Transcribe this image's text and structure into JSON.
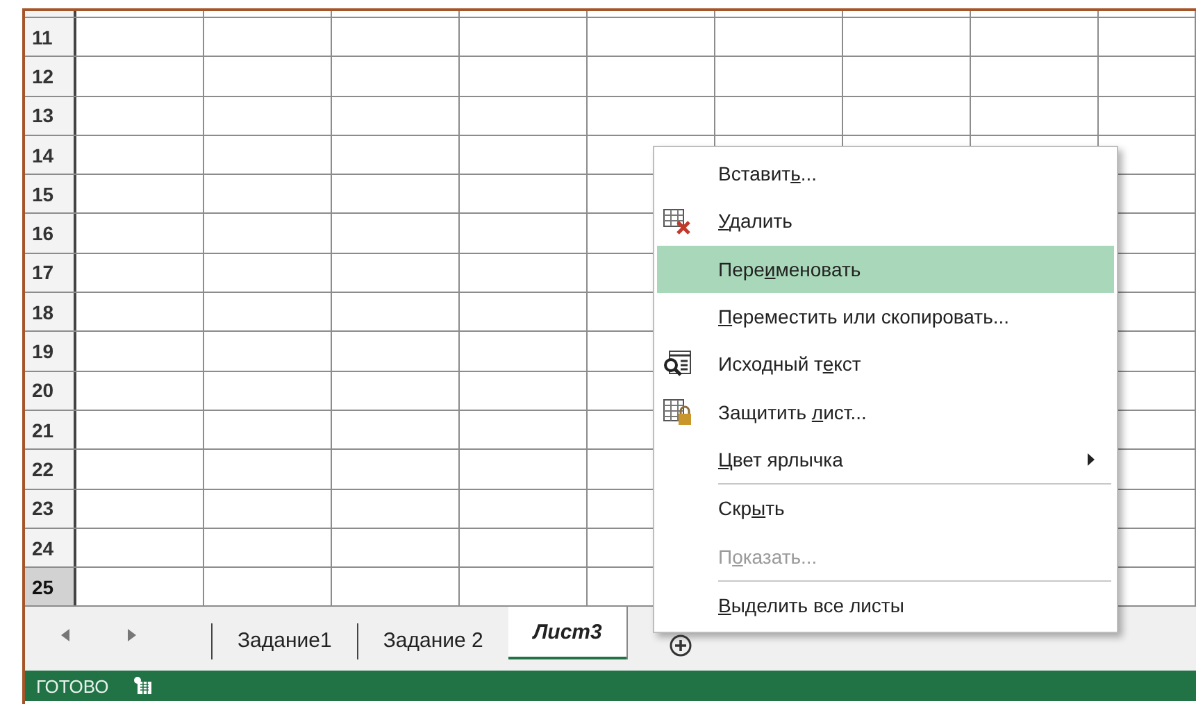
{
  "grid": {
    "rows": [
      {
        "header": "11",
        "selected": false
      },
      {
        "header": "12",
        "selected": false
      },
      {
        "header": "13",
        "selected": false
      },
      {
        "header": "14",
        "selected": false
      },
      {
        "header": "15",
        "selected": false
      },
      {
        "header": "16",
        "selected": false
      },
      {
        "header": "17",
        "selected": false
      },
      {
        "header": "18",
        "selected": false
      },
      {
        "header": "19",
        "selected": false
      },
      {
        "header": "20",
        "selected": false
      },
      {
        "header": "21",
        "selected": false
      },
      {
        "header": "22",
        "selected": false
      },
      {
        "header": "23",
        "selected": false
      },
      {
        "header": "24",
        "selected": false
      },
      {
        "header": "25",
        "selected": true
      }
    ]
  },
  "sheet_tabs": [
    {
      "label": "Задание1",
      "selected": false
    },
    {
      "label": "Задание 2",
      "selected": false
    },
    {
      "label": "Лист3",
      "selected": true
    }
  ],
  "status_bar": {
    "text": "ГОТОВО"
  },
  "context_menu": {
    "items": [
      {
        "kind": "plain",
        "pre": "Вставит",
        "key": "ь",
        "post": "...",
        "selected": false,
        "disabled": false
      },
      {
        "kind": "delete",
        "key": "У",
        "post": "далить",
        "selected": false,
        "disabled": false
      },
      {
        "kind": "plain",
        "pre": "Пере",
        "key": "и",
        "post": "меновать",
        "selected": true,
        "disabled": false
      },
      {
        "kind": "plain",
        "key": "П",
        "post": "ереместить или скопировать...",
        "selected": false,
        "disabled": false
      },
      {
        "kind": "source",
        "pre": "Исходный т",
        "key": "е",
        "post": "кст",
        "selected": false,
        "disabled": false
      },
      {
        "kind": "protect",
        "pre": "Защитить ",
        "key": "л",
        "post": "ист...",
        "selected": false,
        "disabled": false
      },
      {
        "kind": "submenu",
        "key": "Ц",
        "post": "вет ярлычка",
        "selected": false,
        "disabled": false
      },
      {
        "kind": "separator"
      },
      {
        "kind": "plain",
        "pre": "Скр",
        "key": "ы",
        "post": "ть",
        "selected": false,
        "disabled": false
      },
      {
        "kind": "plain",
        "pre": "П",
        "key": "о",
        "post": "казать...",
        "selected": false,
        "disabled": true
      },
      {
        "kind": "separator"
      },
      {
        "kind": "plain",
        "key": "В",
        "post": "ыделить все листы",
        "selected": false,
        "disabled": false
      }
    ]
  }
}
